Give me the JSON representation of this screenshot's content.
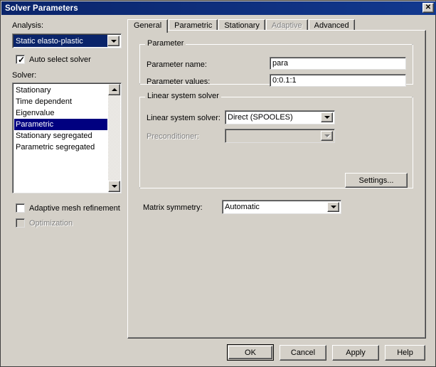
{
  "window": {
    "title": "Solver Parameters",
    "close_label": "✕",
    "titlebar_color": "#0a246a",
    "face_color": "#d4d0c8"
  },
  "left_panel": {
    "analysis_label": "Analysis:",
    "analysis_value": "Static elasto-plastic",
    "auto_select_label": "Auto select solver",
    "auto_select_checked": true,
    "solver_label": "Solver:",
    "solver_items": [
      "Stationary",
      "Time dependent",
      "Eigenvalue",
      "Parametric",
      "Stationary segregated",
      "Parametric segregated"
    ],
    "solver_selected": "Parametric",
    "adaptive_mesh_label": "Adaptive mesh refinement",
    "adaptive_mesh_checked": false,
    "optimization_label": "Optimization",
    "optimization_checked": false,
    "optimization_enabled": false
  },
  "tabs": [
    {
      "label": "General",
      "active": true,
      "enabled": true
    },
    {
      "label": "Parametric",
      "active": false,
      "enabled": true
    },
    {
      "label": "Stationary",
      "active": false,
      "enabled": true
    },
    {
      "label": "Adaptive",
      "active": false,
      "enabled": false
    },
    {
      "label": "Advanced",
      "active": false,
      "enabled": true
    }
  ],
  "general_tab": {
    "parameter_group": {
      "title": "Parameter",
      "name_label": "Parameter name:",
      "name_value": "para",
      "values_label": "Parameter values:",
      "values_value": "0:0.1:1"
    },
    "linear_solver_group": {
      "title": "Linear system solver",
      "solver_label": "Linear system solver:",
      "solver_value": "Direct (SPOOLES)",
      "precond_label": "Preconditioner:",
      "precond_value": "",
      "precond_enabled": false,
      "settings_label": "Settings..."
    },
    "matrix_symmetry_label": "Matrix symmetry:",
    "matrix_symmetry_value": "Automatic"
  },
  "footer": {
    "ok_label": "OK",
    "cancel_label": "Cancel",
    "apply_label": "Apply",
    "help_label": "Help"
  }
}
